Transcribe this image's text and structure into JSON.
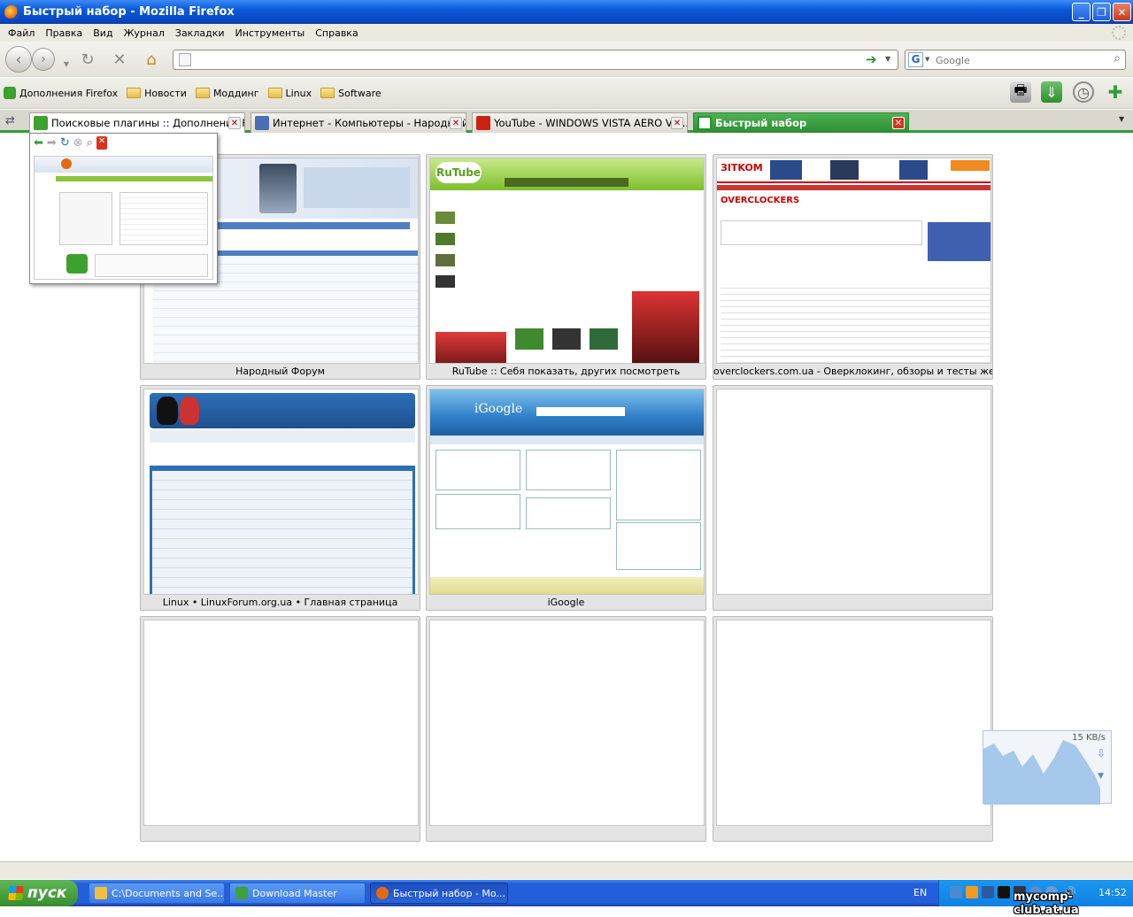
{
  "window": {
    "title": "Быстрый набор - Mozilla Firefox"
  },
  "menu": [
    "Файл",
    "Правка",
    "Вид",
    "Журнал",
    "Закладки",
    "Инструменты",
    "Справка"
  ],
  "navbar": {
    "url_value": "",
    "search_placeholder": "Google"
  },
  "bookmarks": [
    {
      "label": "Дополнения Firefox",
      "icon": "puzzle-icon"
    },
    {
      "label": "Новости",
      "icon": "folder-icon"
    },
    {
      "label": "Моддинг",
      "icon": "folder-icon"
    },
    {
      "label": "Linux",
      "icon": "folder-icon"
    },
    {
      "label": "Software",
      "icon": "folder-icon"
    }
  ],
  "tabs": [
    {
      "label": "Поисковые плагины :: Дополнения Fi...",
      "icon_color": "#3da12f"
    },
    {
      "label": "Интернет - Компьютеры - Народный...",
      "icon_color": "#4a6fb5"
    },
    {
      "label": "YouTube - WINDOWS VISTA AERO VS ...",
      "icon_color": "#cc2211"
    },
    {
      "label": "Быстрый набор",
      "icon_color": "#ffffff",
      "active": true
    }
  ],
  "speed_dial": [
    {
      "caption": "Народный Форум",
      "kind": "forum"
    },
    {
      "caption": "RuTube :: Себя показать, других посмотреть",
      "kind": "rutube"
    },
    {
      "caption": "overclockers.com.ua - Оверклокинг, обзоры и тесты железа",
      "kind": "oc"
    },
    {
      "caption": "Linux • LinuxForum.org.ua • Главная страница",
      "kind": "linux"
    },
    {
      "caption": "iGoogle",
      "kind": "igoogle"
    },
    {
      "caption": "",
      "kind": "empty"
    },
    {
      "caption": "",
      "kind": "empty"
    },
    {
      "caption": "",
      "kind": "empty"
    },
    {
      "caption": "",
      "kind": "empty"
    }
  ],
  "download_widget": {
    "speed": "15 KB/s"
  },
  "taskbar": {
    "start_label": "пуск",
    "tasks": [
      {
        "label": "C:\\Documents and Se...",
        "icon_color": "#f0c040"
      },
      {
        "label": "Download Master",
        "icon_color": "#3ea13a"
      },
      {
        "label": "Быстрый набор - Mo...",
        "icon_color": "#e36a12",
        "active": true
      }
    ],
    "language": "EN",
    "clock": "14:52"
  },
  "watermark": "mycomp-club.at.ua",
  "colors": {
    "accent": "#2f9e3a",
    "titlebar": "#0a5ad8"
  }
}
